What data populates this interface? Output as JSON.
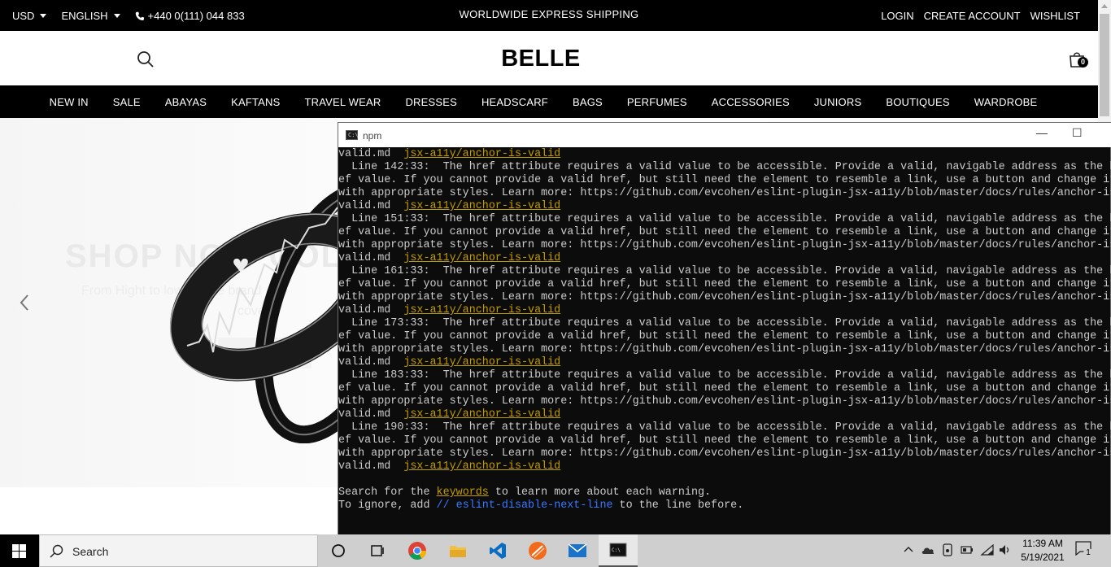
{
  "topbar": {
    "currency": "USD",
    "language": "ENGLISH",
    "phone": "+440 0(111) 044 833",
    "shipping": "WORLDWIDE EXPRESS SHIPPING",
    "login": "LOGIN",
    "create_account": "CREATE ACCOUNT",
    "wishlist": "WISHLIST"
  },
  "header": {
    "logo": "BELLE",
    "cart_count": "0"
  },
  "nav": [
    "NEW IN",
    "SALE",
    "ABAYAS",
    "KAFTANS",
    "TRAVEL WEAR",
    "DRESSES",
    "HEADSCARF",
    "BAGS",
    "PERFUMES",
    "ACCESSORIES",
    "JUNIORS",
    "BOUTIQUES",
    "WARDROBE"
  ],
  "hero": {
    "heading": "SHOP NOW COLL",
    "sub1": "From Hight to low, Name brand",
    "sub2": "cove"
  },
  "window": {
    "title": "npm",
    "lines": [
      {
        "pre": "valid.md  ",
        "link": "jsx-a11y/anchor-is-valid",
        "post": ""
      },
      {
        "pre": "  Line 142:33:  The href attribute requires a valid value to be accessible. Provide a valid, navigable address as the href",
        "link": "",
        "post": ""
      },
      {
        "pre": "ef value. If you cannot provide a valid href, but still need the element to resemble a link, use a button and change it",
        "link": "",
        "post": ""
      },
      {
        "pre": "with appropriate styles. Learn more: https://github.com/evcohen/eslint-plugin-jsx-a11y/blob/master/docs/rules/anchor-is-",
        "link": "",
        "post": ""
      },
      {
        "pre": "valid.md  ",
        "link": "jsx-a11y/anchor-is-valid",
        "post": ""
      },
      {
        "pre": "  Line 151:33:  The href attribute requires a valid value to be accessible. Provide a valid, navigable address as the href",
        "link": "",
        "post": ""
      },
      {
        "pre": "ef value. If you cannot provide a valid href, but still need the element to resemble a link, use a button and change it",
        "link": "",
        "post": ""
      },
      {
        "pre": "with appropriate styles. Learn more: https://github.com/evcohen/eslint-plugin-jsx-a11y/blob/master/docs/rules/anchor-is-",
        "link": "",
        "post": ""
      },
      {
        "pre": "valid.md  ",
        "link": "jsx-a11y/anchor-is-valid",
        "post": ""
      },
      {
        "pre": "  Line 161:33:  The href attribute requires a valid value to be accessible. Provide a valid, navigable address as the href",
        "link": "",
        "post": ""
      },
      {
        "pre": "ef value. If you cannot provide a valid href, but still need the element to resemble a link, use a button and change it",
        "link": "",
        "post": ""
      },
      {
        "pre": "with appropriate styles. Learn more: https://github.com/evcohen/eslint-plugin-jsx-a11y/blob/master/docs/rules/anchor-is-",
        "link": "",
        "post": ""
      },
      {
        "pre": "valid.md  ",
        "link": "jsx-a11y/anchor-is-valid",
        "post": ""
      },
      {
        "pre": "  Line 173:33:  The href attribute requires a valid value to be accessible. Provide a valid, navigable address as the href",
        "link": "",
        "post": ""
      },
      {
        "pre": "ef value. If you cannot provide a valid href, but still need the element to resemble a link, use a button and change it",
        "link": "",
        "post": ""
      },
      {
        "pre": "with appropriate styles. Learn more: https://github.com/evcohen/eslint-plugin-jsx-a11y/blob/master/docs/rules/anchor-is-",
        "link": "",
        "post": ""
      },
      {
        "pre": "valid.md  ",
        "link": "jsx-a11y/anchor-is-valid",
        "post": ""
      },
      {
        "pre": "  Line 183:33:  The href attribute requires a valid value to be accessible. Provide a valid, navigable address as the href",
        "link": "",
        "post": ""
      },
      {
        "pre": "ef value. If you cannot provide a valid href, but still need the element to resemble a link, use a button and change it",
        "link": "",
        "post": ""
      },
      {
        "pre": "with appropriate styles. Learn more: https://github.com/evcohen/eslint-plugin-jsx-a11y/blob/master/docs/rules/anchor-is-",
        "link": "",
        "post": ""
      },
      {
        "pre": "valid.md  ",
        "link": "jsx-a11y/anchor-is-valid",
        "post": ""
      },
      {
        "pre": "  Line 190:33:  The href attribute requires a valid value to be accessible. Provide a valid, navigable address as the href",
        "link": "",
        "post": ""
      },
      {
        "pre": "ef value. If you cannot provide a valid href, but still need the element to resemble a link, use a button and change it",
        "link": "",
        "post": ""
      },
      {
        "pre": "with appropriate styles. Learn more: https://github.com/evcohen/eslint-plugin-jsx-a11y/blob/master/docs/rules/anchor-is-",
        "link": "",
        "post": ""
      },
      {
        "pre": "valid.md  ",
        "link": "jsx-a11y/anchor-is-valid",
        "post": ""
      },
      {
        "pre": "",
        "link": "",
        "post": ""
      },
      {
        "pre": "Search for the ",
        "link": "keywords",
        "post": " to learn more about each warning."
      },
      {
        "pre": "To ignore, add ",
        "comment": "// eslint-disable-next-line",
        "post": " to the line before."
      }
    ]
  },
  "taskbar": {
    "search_label": "Search",
    "time": "11:39 AM",
    "date": "5/19/2021",
    "notification_count": "1"
  },
  "colors": {
    "accent": "#000000",
    "terminal_bg": "#0c0c0c",
    "terminal_link": "#c19c00",
    "terminal_comment": "#3b78ff"
  },
  "icons": [
    "search-icon",
    "cart-icon",
    "phone-icon",
    "chevron-left-icon",
    "windows-start-icon",
    "cortana-icon",
    "task-view-icon",
    "chrome-icon",
    "file-explorer-icon",
    "vscode-icon",
    "app-icon",
    "mail-icon",
    "cmd-icon"
  ]
}
